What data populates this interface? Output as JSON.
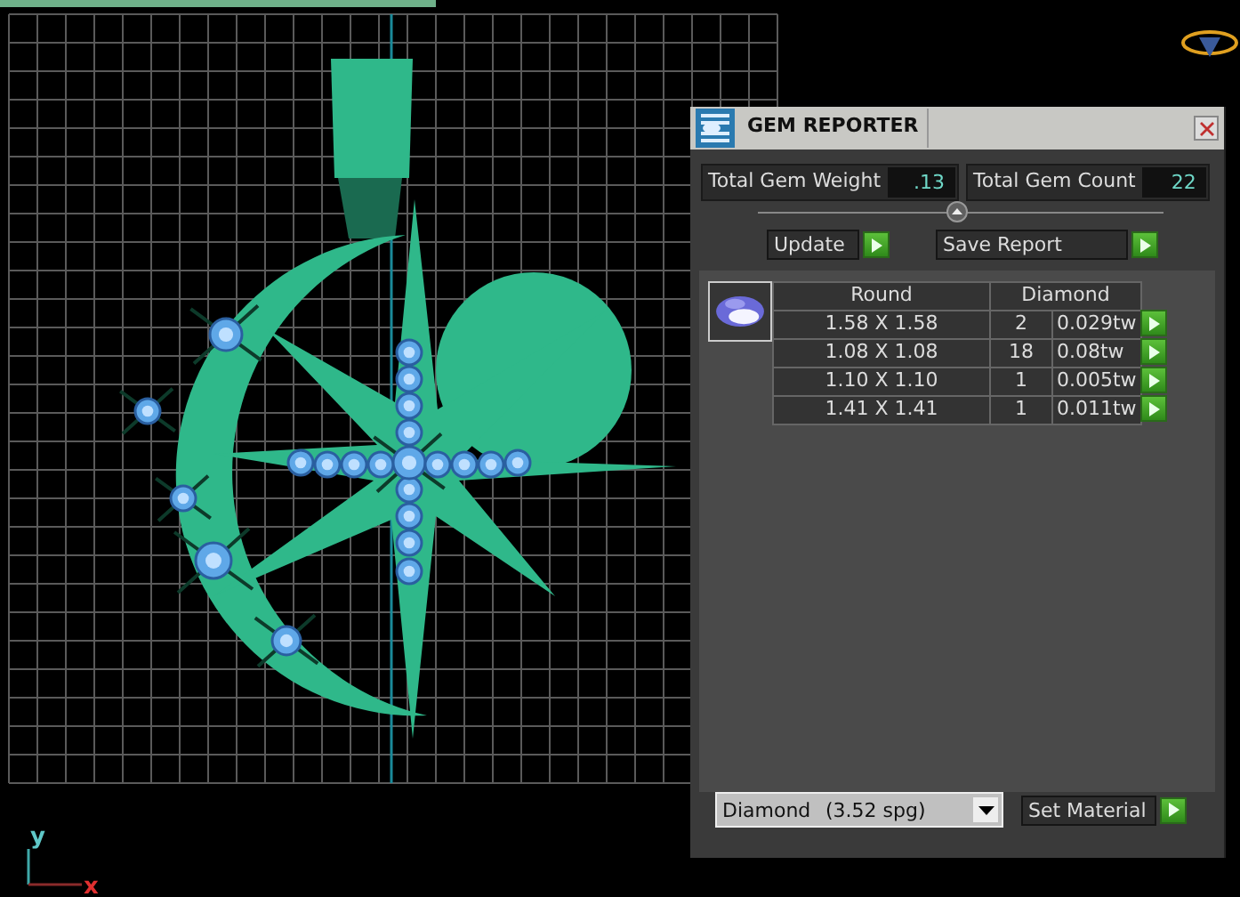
{
  "viewport": {
    "axis_x": "x",
    "axis_y": "y"
  },
  "panel": {
    "title": "GEM REPORTER",
    "totals": [
      {
        "label": "Total Gem Weight",
        "value": ".13"
      },
      {
        "label": "Total Gem Count",
        "value": "22"
      }
    ],
    "buttons": [
      {
        "label": "Update"
      },
      {
        "label": "Save Report"
      }
    ],
    "table": {
      "columns": [
        "Round",
        "Diamond"
      ],
      "rows": [
        {
          "size": "1.58 X 1.58",
          "count": "2",
          "weight": "0.029tw"
        },
        {
          "size": "1.08 X 1.08",
          "count": "18",
          "weight": "0.08tw"
        },
        {
          "size": "1.10 X 1.10",
          "count": "1",
          "weight": "0.005tw"
        },
        {
          "size": "1.41 X 1.41",
          "count": "1",
          "weight": "0.011tw"
        }
      ]
    },
    "material": {
      "name": "Diamond",
      "gravity": "(3.52 spg)"
    },
    "set_button": "Set Material"
  }
}
